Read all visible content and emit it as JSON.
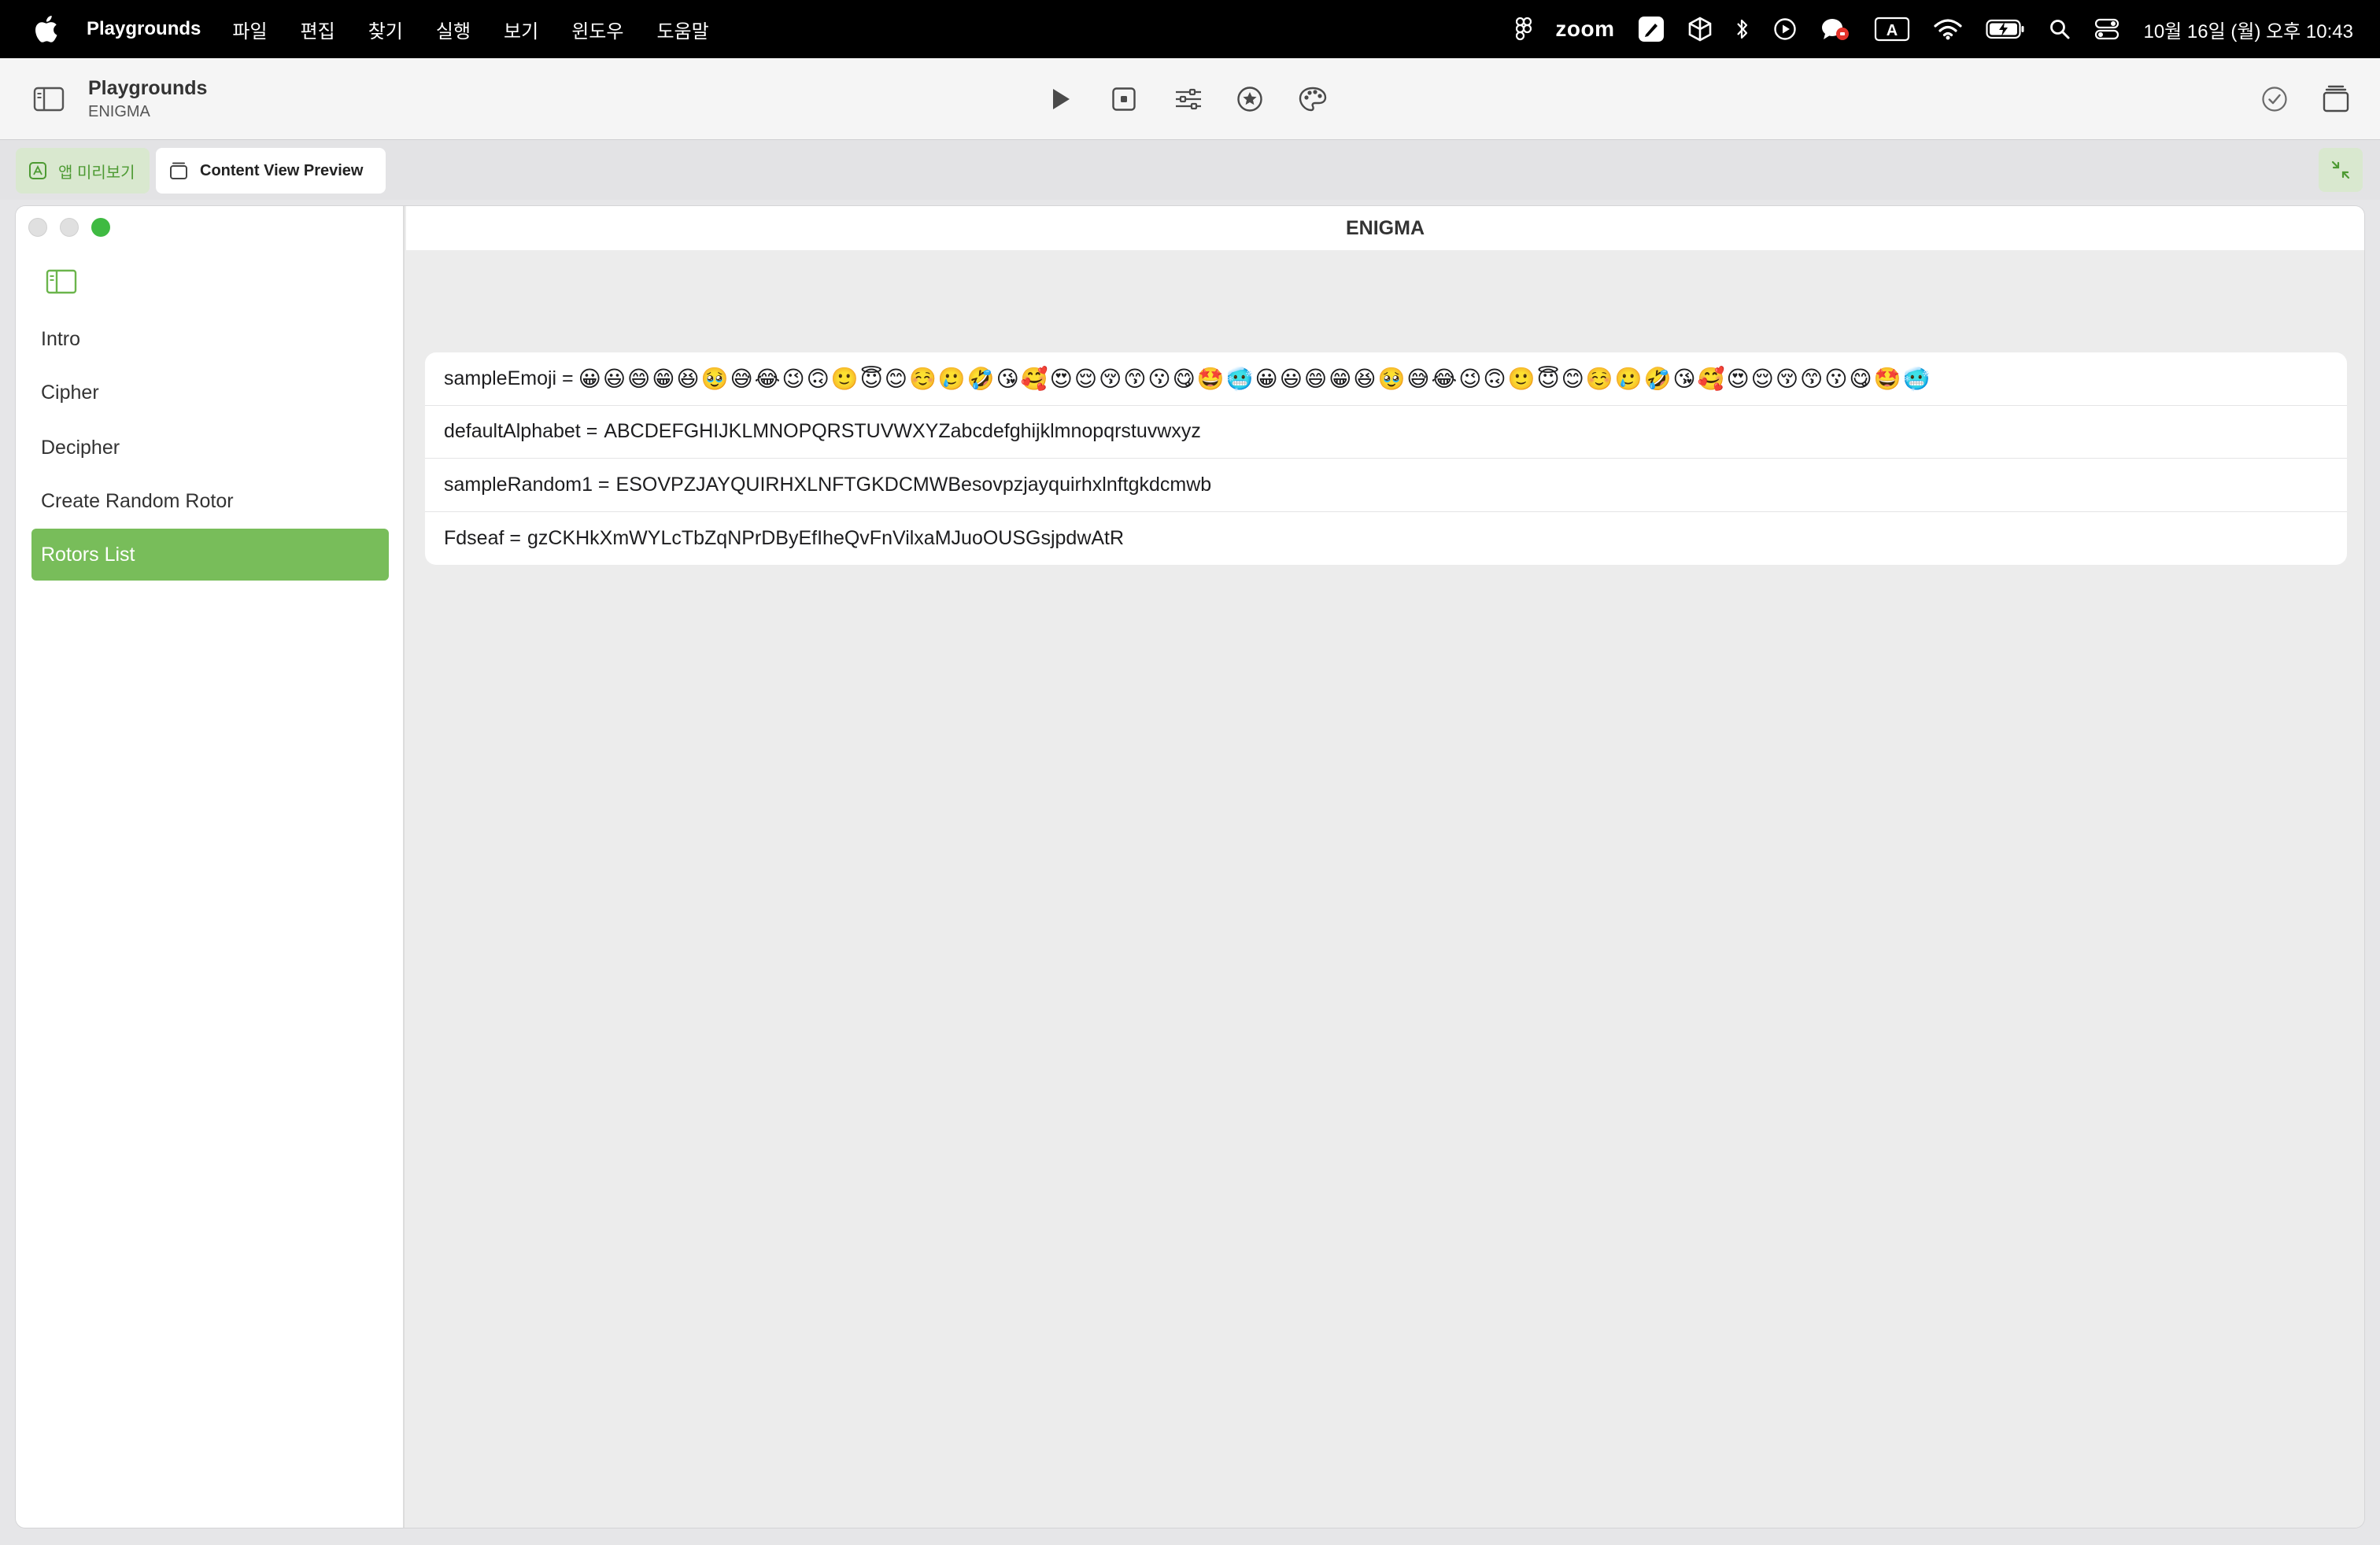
{
  "menubar": {
    "app_name": "Playgrounds",
    "menus": [
      "파일",
      "편집",
      "찾기",
      "실행",
      "보기",
      "윈도우",
      "도움말"
    ],
    "zoom_label": "zoom",
    "keyboard_label": "A",
    "clock": "10월 16일 (월) 오후 10:43",
    "status_icons": [
      "figma-icon",
      "zoom-icon",
      "pencil-app-icon",
      "unity-icon",
      "bluetooth-icon",
      "play-circle-icon",
      "chat-badge-icon",
      "input-source-icon",
      "wifi-icon",
      "battery-icon",
      "spotlight-search-icon",
      "control-center-icon"
    ]
  },
  "toolbar": {
    "title": "Playgrounds",
    "subtitle": "ENIGMA"
  },
  "tabs": {
    "app_preview": "앱 미리보기",
    "content_view_preview": "Content View Preview"
  },
  "sidebar": {
    "items": [
      {
        "label": "Intro",
        "selected": false
      },
      {
        "label": "Cipher",
        "selected": false
      },
      {
        "label": "Decipher",
        "selected": false
      },
      {
        "label": "Create Random Rotor",
        "selected": false
      },
      {
        "label": "Rotors List",
        "selected": true
      }
    ]
  },
  "detail": {
    "nav_title": "ENIGMA",
    "rows": [
      {
        "label": "sampleEmoji =",
        "value": "😀😃😄😁😆🥹😅😂😉🙃🙂😇😊☺️🥲🤣😘🥰😍😌😚😙😗😋🤩🥶😀😃😄😁😆🥹😅😂😉🙃🙂😇😊☺️🥲🤣😘🥰😍😌😚😙😗😋🤩🥶"
      },
      {
        "label": "defaultAlphabet =",
        "value": "ABCDEFGHIJKLMNOPQRSTUVWXYZabcdefghijklmnopqrstuvwxyz"
      },
      {
        "label": "sampleRandom1 =",
        "value": "ESOVPZJAYQUIRHXLNFTGKDCMWBesovpzjayquirhxlnftgkdcmwb"
      },
      {
        "label": "Fdseaf =",
        "value": "gzCKHkXmWYLcTbZqNPrDByEfIheQvFnVilxaMJuoOUSGsjpdwAtR"
      }
    ]
  },
  "colors": {
    "accent_green": "#78bd5a",
    "tab_green_bg": "#d9e8cf",
    "tab_green_text": "#4d9a33",
    "menubar_bg": "#000000"
  }
}
